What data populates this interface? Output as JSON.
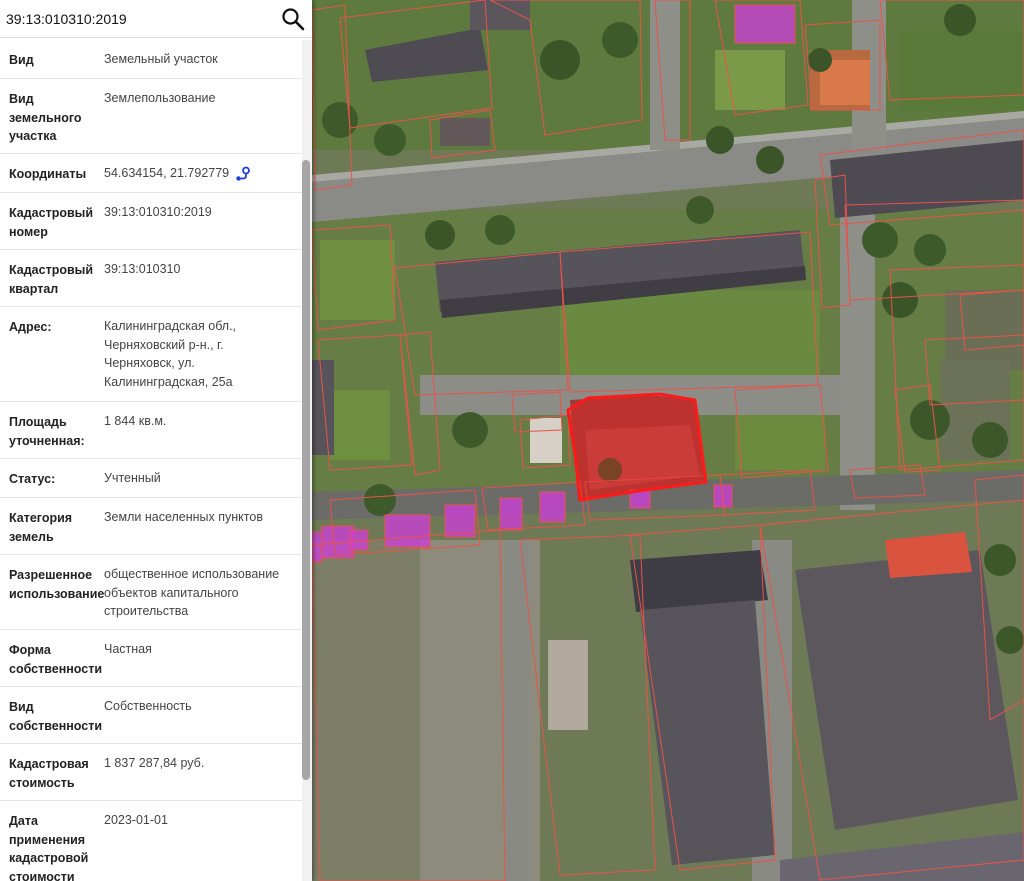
{
  "search": {
    "value": "39:13:010310:2019"
  },
  "icons": {
    "search": "search-icon",
    "locate": "map-pin-route-icon"
  },
  "colors": {
    "parcel_border": "#e8534a",
    "selected_parcel": "#ff1a1a",
    "zone_fill": "#d23cdc"
  },
  "details": [
    {
      "key": "type",
      "label": "Вид",
      "value": "Земельный участок"
    },
    {
      "key": "land-type",
      "label": "Вид земельного участка",
      "value": "Землепользование"
    },
    {
      "key": "coordinates",
      "label": "Координаты",
      "value": "54.634154, 21.792779"
    },
    {
      "key": "cadastral-number",
      "label": "Кадастровый номер",
      "value": "39:13:010310:2019"
    },
    {
      "key": "cadastral-quarter",
      "label": "Кадастровый квартал",
      "value": "39:13:010310"
    },
    {
      "key": "address",
      "label": "Адрес:",
      "value": "Калининградская обл., Черняховский р-н., г. Черняховск, ул. Калининградская, 25а"
    },
    {
      "key": "area",
      "label": "Площадь уточненная:",
      "value": "1 844 кв.м."
    },
    {
      "key": "status",
      "label": "Статус:",
      "value": "Учтенный"
    },
    {
      "key": "land-category",
      "label": "Категория земель",
      "value": "Земли населенных пунктов"
    },
    {
      "key": "permitted-use",
      "label": "Разрешенное использование",
      "value": "общественное использование объектов капитального строительства"
    },
    {
      "key": "ownership-form",
      "label": "Форма собственности",
      "value": "Частная"
    },
    {
      "key": "ownership-type",
      "label": "Вид собственности",
      "value": "Собственность"
    },
    {
      "key": "cadastral-value",
      "label": "Кадастровая стоимость",
      "value": "1 837 287,84 руб."
    },
    {
      "key": "valuation-date",
      "label": "Дата применения кадастровой стоимости",
      "value": "2023-01-01"
    }
  ]
}
